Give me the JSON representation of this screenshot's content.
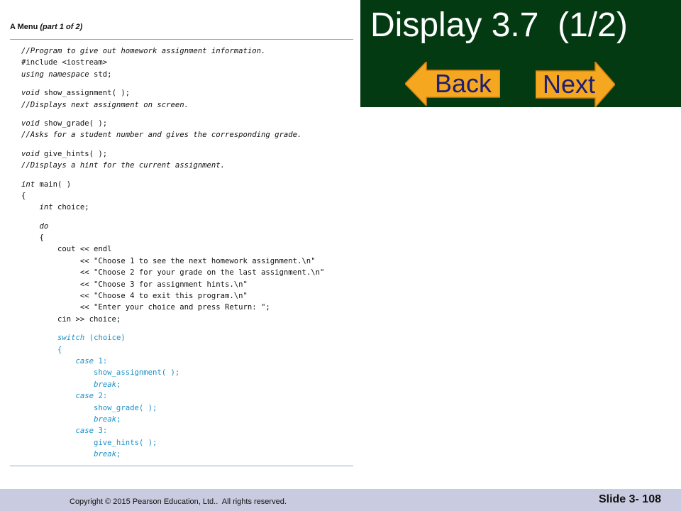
{
  "slide": {
    "title": "Display 3.7  (1/2)",
    "back_label": "Back",
    "next_label": "Next",
    "copyright": "Copyright © 2015 Pearson Education, Ltd..  All rights reserved.",
    "slide_number": "Slide 3- 108"
  },
  "figure": {
    "caption_prefix": "A Menu ",
    "caption_part": "(part 1 of 2)"
  },
  "code_lines": [
    "//Program to give out homework assignment information.",
    "#include <iostream>",
    "using namespace std;",
    "",
    "void show_assignment( );",
    "//Displays next assignment on screen.",
    "",
    "void show_grade( );",
    "//Asks for a student number and gives the corresponding grade.",
    "",
    "void give_hints( );",
    "//Displays a hint for the current assignment.",
    "",
    "int main( )",
    "{",
    "    int choice;",
    "",
    "    do",
    "    {",
    "        cout << endl",
    "             << \"Choose 1 to see the next homework assignment.\\n\"",
    "             << \"Choose 2 for your grade on the last assignment.\\n\"",
    "             << \"Choose 3 for assignment hints.\\n\"",
    "             << \"Choose 4 to exit this program.\\n\"",
    "             << \"Enter your choice and press Return: \";",
    "        cin >> choice;",
    "",
    "        switch (choice)",
    "        {",
    "            case 1:",
    "                show_assignment( );",
    "                break;",
    "            case 2:",
    "                show_grade( );",
    "                break;",
    "            case 3:",
    "                give_hints( );",
    "                break;"
  ],
  "highlight_from": 27,
  "italic_keywords": [
    "using namespace",
    "void",
    "int",
    "do",
    "switch",
    "case",
    "break",
    "//"
  ],
  "colors": {
    "header_bg": "#043a12",
    "button_fill": "#f5a81f",
    "button_label": "#1e1e73",
    "code_highlight": "#1a8fc7",
    "footer_bg": "#c9cbe0"
  }
}
